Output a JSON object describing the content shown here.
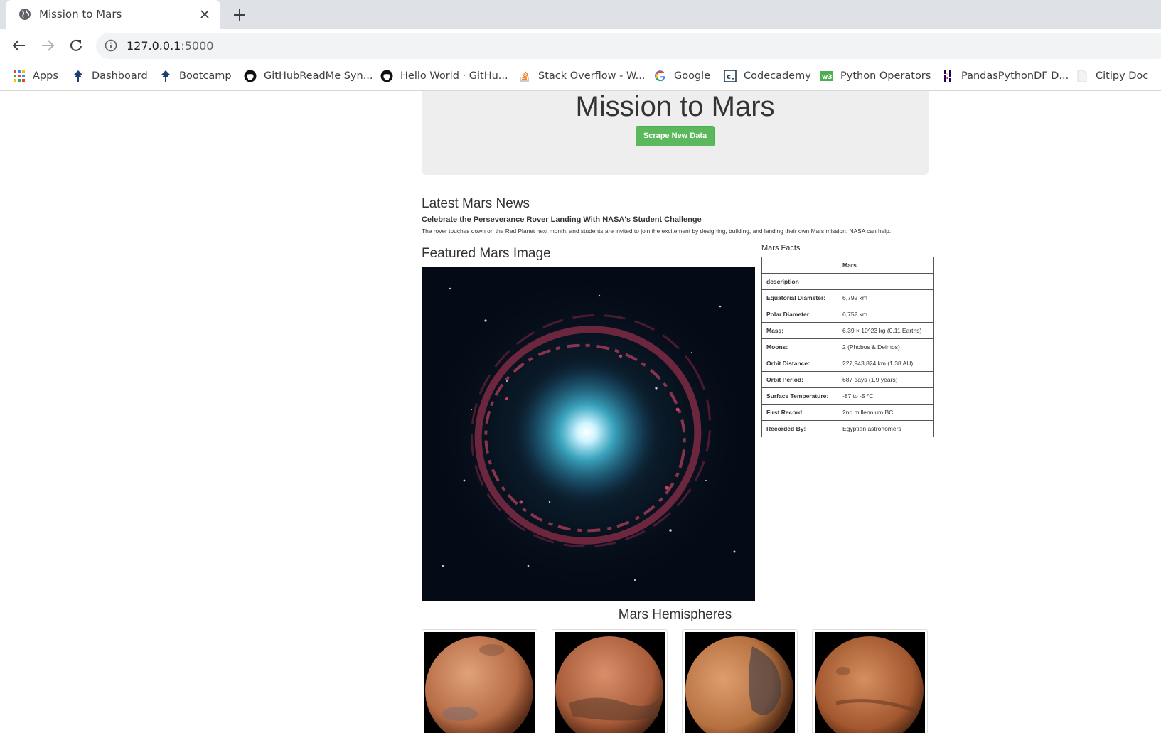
{
  "browser": {
    "tab_title": "Mission to Mars",
    "url_host": "127.0.0.1",
    "url_port": ":5000",
    "bookmarks": [
      {
        "label": "Apps",
        "icon": "apps-grid-icon"
      },
      {
        "label": "Dashboard",
        "icon": "tree-icon"
      },
      {
        "label": "Bootcamp",
        "icon": "tree-icon"
      },
      {
        "label": "GitHubReadMe Syn...",
        "icon": "github-icon"
      },
      {
        "label": "Hello World · GitHu...",
        "icon": "github-icon"
      },
      {
        "label": "Stack Overflow - W...",
        "icon": "stackoverflow-icon"
      },
      {
        "label": "Google",
        "icon": "google-icon"
      },
      {
        "label": "Codecademy",
        "icon": "codecademy-icon"
      },
      {
        "label": "Python Operators",
        "icon": "w3schools-icon"
      },
      {
        "label": "PandasPythonDF D...",
        "icon": "pandas-icon"
      },
      {
        "label": "Citipy Doc",
        "icon": "page-icon"
      }
    ]
  },
  "page": {
    "title": "Mission to Mars",
    "scrape_button": "Scrape New Data",
    "news": {
      "heading": "Latest Mars News",
      "title": "Celebrate the Perseverance Rover Landing With NASA's Student Challenge",
      "paragraph": "The rover touches down on the Red Planet next month, and students are invited to join the excitement by designing, building, and landing their own Mars mission. NASA can help."
    },
    "featured": {
      "heading": "Featured Mars Image"
    },
    "facts": {
      "heading": "Mars Facts",
      "column_header": "Mars",
      "rows": [
        {
          "key": "description",
          "value": ""
        },
        {
          "key": "Equatorial Diameter:",
          "value": "6,792 km"
        },
        {
          "key": "Polar Diameter:",
          "value": "6,752 km"
        },
        {
          "key": "Mass:",
          "value": "6.39 × 10^23 kg (0.11 Earths)"
        },
        {
          "key": "Moons:",
          "value": "2 (Phobos & Deimos)"
        },
        {
          "key": "Orbit Distance:",
          "value": "227,943,824 km (1.38 AU)"
        },
        {
          "key": "Orbit Period:",
          "value": "687 days (1.9 years)"
        },
        {
          "key": "Surface Temperature:",
          "value": "-87 to -5 °C"
        },
        {
          "key": "First Record:",
          "value": "2nd millennium BC"
        },
        {
          "key": "Recorded By:",
          "value": "Egyptian astronomers"
        }
      ]
    },
    "hemispheres": {
      "heading": "Mars Hemispheres"
    }
  },
  "colors": {
    "button_green": "#5cb85c",
    "jumbotron_gray": "#eeeeee",
    "tabstrip": "#dee1e6"
  }
}
